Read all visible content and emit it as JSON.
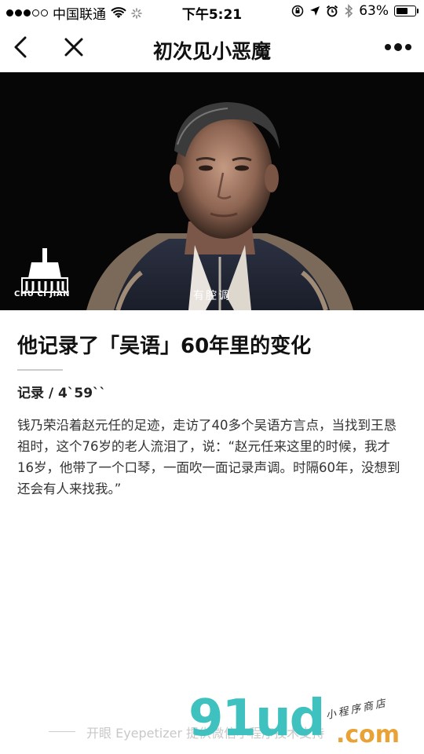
{
  "status_bar": {
    "carrier": "中国联通",
    "time": "下午5:21",
    "battery": "63%",
    "battery_level": 0.63,
    "icons": [
      "signal-dots-icon",
      "wifi-icon",
      "loading-icon",
      "orientation-lock-icon",
      "location-arrow-icon",
      "alarm-icon",
      "bluetooth-icon",
      "battery-icon"
    ]
  },
  "nav": {
    "title": "初次见小恶魔",
    "back_icon": "chevron-left-icon",
    "close_icon": "close-icon",
    "more_icon": "more-dots-icon"
  },
  "video": {
    "logo_text": "CHU CI JIAN",
    "subtitle": "有腔调"
  },
  "article": {
    "title": "他记录了「吴语」60年里的变化",
    "meta": "记录 / 4`59``",
    "body": "钱乃荣沿着赵元任的足迹，走访了40多个吴语方言点，当找到王恳祖时，这个76岁的老人流泪了，说：“赵元任来这里的时候，我才16岁，他带了一个口琴，一面吹一面记录声调。时隔60年，没想到还会有人来找我。”"
  },
  "footer": {
    "text": "开眼 Eyepetizer 提供微信小程序技术支持"
  },
  "watermark": {
    "brand": "91ud",
    "suffix": ".com",
    "tagline": "小程序商店",
    "colors": {
      "brand": "#3fc1c0",
      "suffix": "#e8a235"
    }
  }
}
